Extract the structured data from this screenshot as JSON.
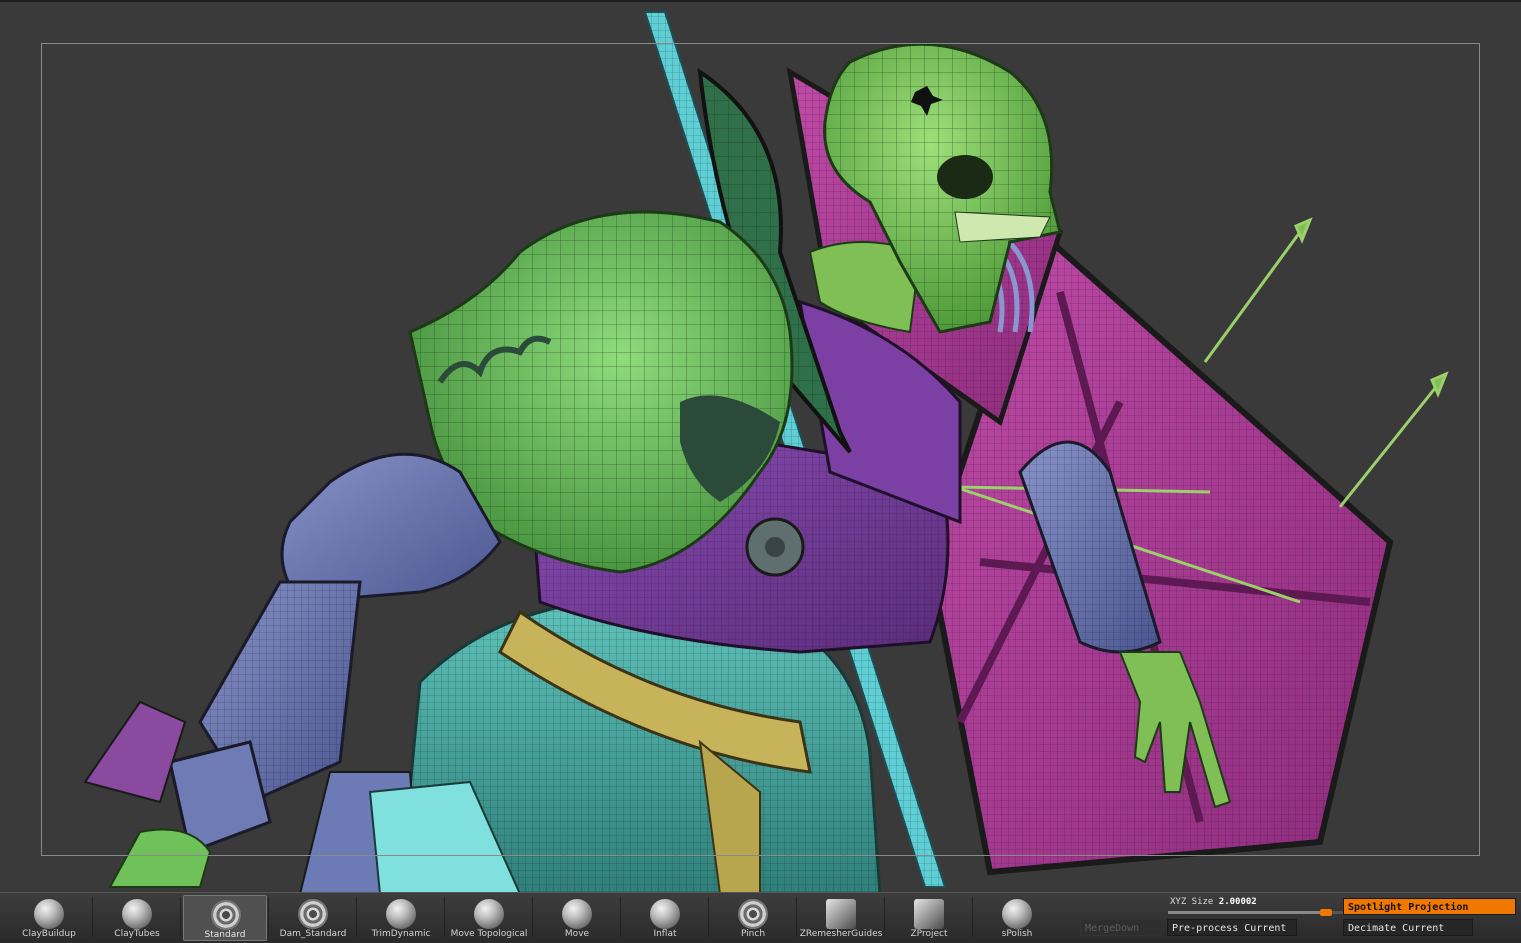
{
  "viewport": {
    "background": "#3a3a3a",
    "model_icon": "armored-skeleton-knight-wireframe-model"
  },
  "colors": {
    "bone_green": "#6fc25a",
    "armor_purple": "#7a3fa0",
    "shield_magenta": "#b03a9a",
    "steel_blue": "#6a78b0",
    "teal": "#4fb8b0",
    "spear_cyan": "#5fcfd6",
    "belt_yellow": "#c7b45a",
    "accent_orange": "#f07800"
  },
  "brush_shelf": {
    "brushes": [
      {
        "label": "ClayBuildup",
        "icon": "clay-buildup-sphere-icon"
      },
      {
        "label": "ClayTubes",
        "icon": "clay-tubes-sphere-icon"
      },
      {
        "label": "Standard",
        "icon": "standard-swirl-icon",
        "selected": true
      },
      {
        "label": "Dam_Standard",
        "icon": "dam-standard-swirl-icon"
      },
      {
        "label": "TrimDynamic",
        "icon": "trim-dynamic-sphere-icon"
      },
      {
        "label": "Move Topological",
        "icon": "move-topological-icon"
      },
      {
        "label": "Move",
        "icon": "move-sphere-icon"
      },
      {
        "label": "Inflat",
        "icon": "inflat-sphere-icon"
      },
      {
        "label": "Pinch",
        "icon": "pinch-swirl-icon"
      },
      {
        "label": "ZRemesherGuides",
        "icon": "zremesher-guides-cube-icon"
      },
      {
        "label": "ZProject",
        "icon": "zproject-cube-icon"
      },
      {
        "label": "sPolish",
        "icon": "spolish-icon"
      }
    ]
  },
  "controls": {
    "xyz_size_label": "XYZ Size",
    "xyz_size_value": "2.00002",
    "xyz_size_fraction": 0.63,
    "merge_down_label": "MergeDown",
    "preprocess_label": "Pre-process Current",
    "spotlight_label": "Spotlight Projection",
    "decimate_label": "Decimate Current"
  }
}
